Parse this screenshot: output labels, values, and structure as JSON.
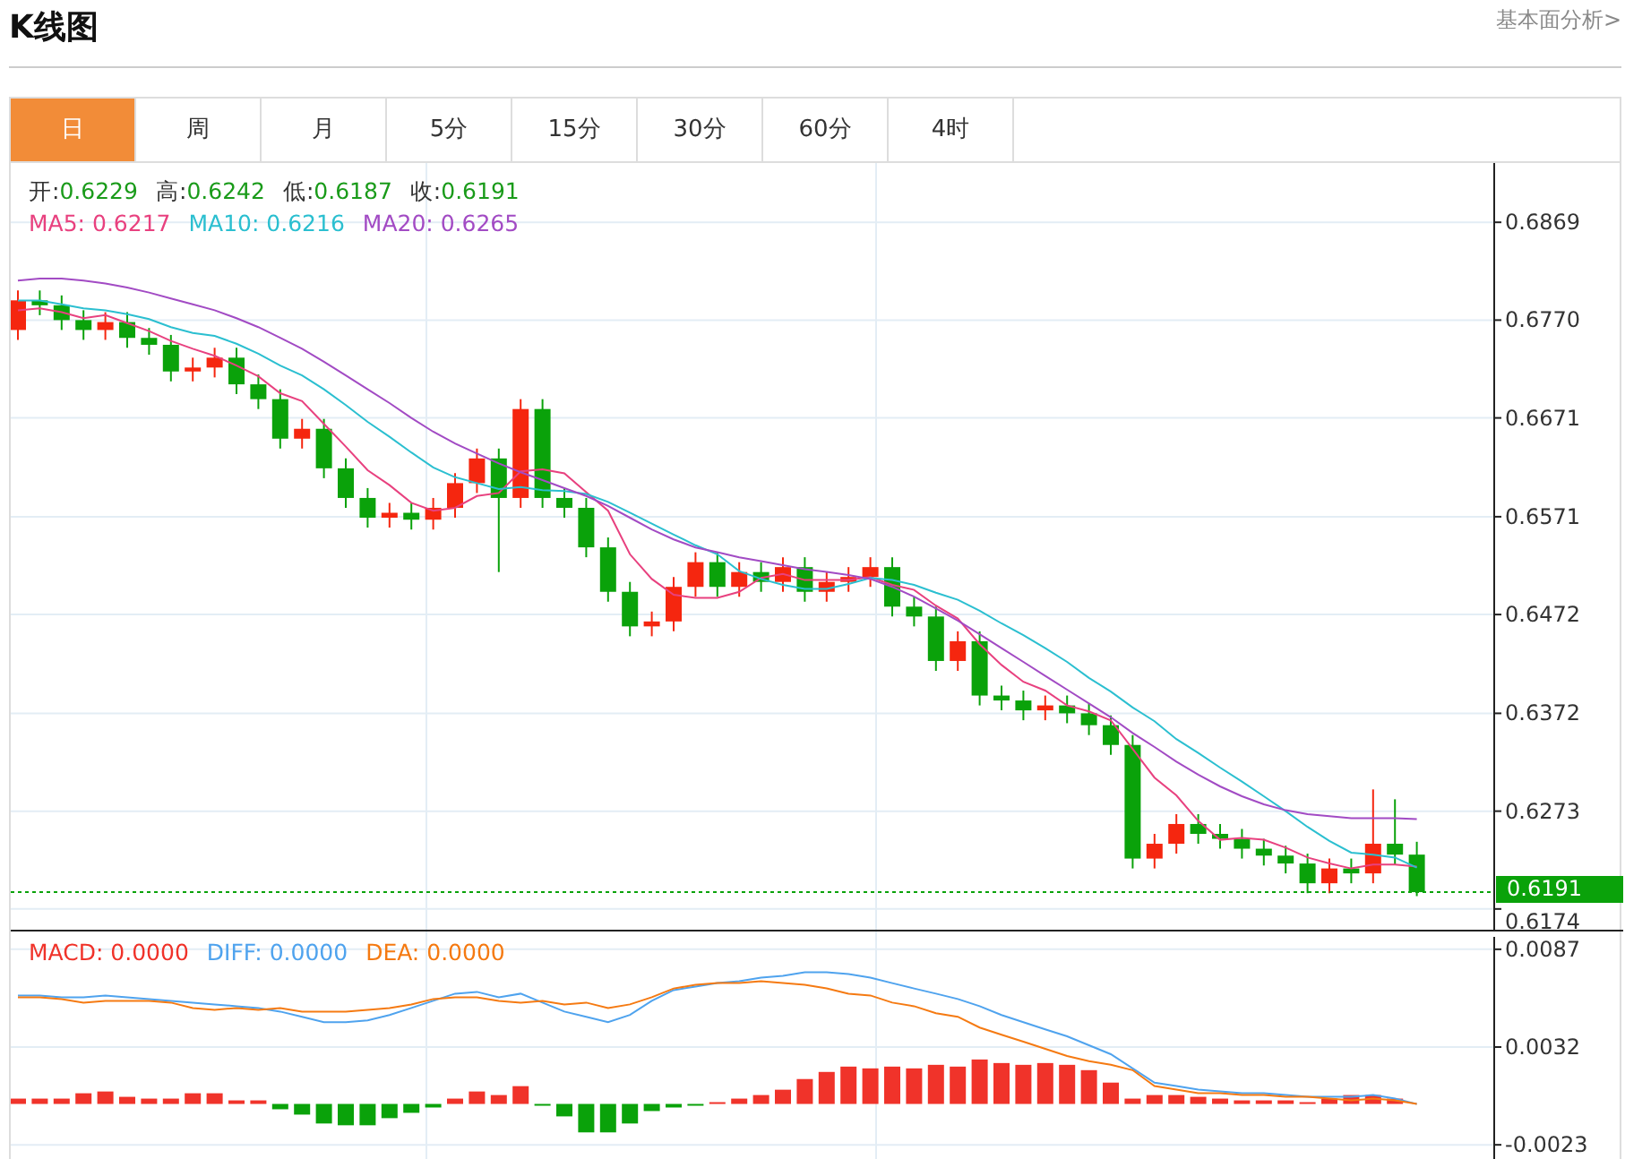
{
  "header": {
    "title": "K线图",
    "link": "基本面分析>"
  },
  "tabs": [
    {
      "label": "日",
      "selected": true
    },
    {
      "label": "周",
      "selected": false
    },
    {
      "label": "月",
      "selected": false
    },
    {
      "label": "5分",
      "selected": false
    },
    {
      "label": "15分",
      "selected": false
    },
    {
      "label": "30分",
      "selected": false
    },
    {
      "label": "60分",
      "selected": false
    },
    {
      "label": "4时",
      "selected": false
    }
  ],
  "quote": [
    {
      "label": "开:",
      "value": "0.6229"
    },
    {
      "label": "高:",
      "value": "0.6242"
    },
    {
      "label": "低:",
      "value": "0.6187"
    },
    {
      "label": "收:",
      "value": "0.6191"
    }
  ],
  "price_chart": {
    "legend": [
      {
        "value": "0.6217"
      },
      {
        "value": "0.6216"
      },
      {
        "value": "0.6265"
      }
    ],
    "chart_data": {
      "type": "candlestick",
      "grid": true,
      "ylim": [
        0.6153,
        0.6929
      ],
      "categories": [
        null,
        null,
        null,
        null,
        null,
        null,
        null,
        null,
        null,
        null,
        null,
        null,
        null,
        null,
        null,
        null,
        null,
        null,
        null,
        null,
        null,
        null,
        null,
        null,
        null,
        null,
        null,
        null,
        null,
        null,
        null,
        null,
        null,
        null,
        null,
        null,
        null,
        null,
        null,
        null,
        null,
        null,
        null,
        null,
        null,
        null,
        null,
        null,
        null,
        null,
        null,
        null,
        null,
        null,
        null,
        null,
        null,
        null,
        null,
        null,
        null,
        null,
        null,
        null,
        null
      ],
      "ohlc": [
        [
          0.676,
          0.68,
          0.675,
          0.679
        ],
        [
          0.679,
          0.68,
          0.6775,
          0.6785
        ],
        [
          0.6785,
          0.6795,
          0.676,
          0.677
        ],
        [
          0.677,
          0.678,
          0.675,
          0.676
        ],
        [
          0.676,
          0.6778,
          0.675,
          0.6768
        ],
        [
          0.6768,
          0.6778,
          0.6742,
          0.6752
        ],
        [
          0.6752,
          0.6762,
          0.6735,
          0.6745
        ],
        [
          0.6745,
          0.6755,
          0.6708,
          0.6718
        ],
        [
          0.6718,
          0.6732,
          0.6708,
          0.6722
        ],
        [
          0.6722,
          0.6742,
          0.6712,
          0.6732
        ],
        [
          0.6732,
          0.6742,
          0.6695,
          0.6705
        ],
        [
          0.6705,
          0.6715,
          0.668,
          0.669
        ],
        [
          0.669,
          0.67,
          0.664,
          0.665
        ],
        [
          0.665,
          0.667,
          0.664,
          0.666
        ],
        [
          0.666,
          0.667,
          0.661,
          0.662
        ],
        [
          0.662,
          0.663,
          0.658,
          0.659
        ],
        [
          0.659,
          0.66,
          0.656,
          0.657
        ],
        [
          0.657,
          0.6585,
          0.656,
          0.6575
        ],
        [
          0.6575,
          0.6585,
          0.6558,
          0.6568
        ],
        [
          0.6568,
          0.659,
          0.6558,
          0.658
        ],
        [
          0.658,
          0.6615,
          0.657,
          0.6605
        ],
        [
          0.6605,
          0.664,
          0.6595,
          0.663
        ],
        [
          0.663,
          0.664,
          0.6515,
          0.659
        ],
        [
          0.659,
          0.669,
          0.658,
          0.668
        ],
        [
          0.668,
          0.669,
          0.658,
          0.659
        ],
        [
          0.659,
          0.66,
          0.657,
          0.658
        ],
        [
          0.658,
          0.659,
          0.653,
          0.654
        ],
        [
          0.654,
          0.655,
          0.6485,
          0.6495
        ],
        [
          0.6495,
          0.6505,
          0.645,
          0.646
        ],
        [
          0.646,
          0.6475,
          0.645,
          0.6465
        ],
        [
          0.6465,
          0.651,
          0.6455,
          0.65
        ],
        [
          0.65,
          0.6535,
          0.649,
          0.6525
        ],
        [
          0.6525,
          0.6535,
          0.649,
          0.65
        ],
        [
          0.65,
          0.6525,
          0.649,
          0.6515
        ],
        [
          0.6515,
          0.6525,
          0.6495,
          0.6505
        ],
        [
          0.6505,
          0.653,
          0.6495,
          0.652
        ],
        [
          0.652,
          0.653,
          0.6485,
          0.6495
        ],
        [
          0.6495,
          0.6515,
          0.6485,
          0.6505
        ],
        [
          0.6505,
          0.652,
          0.6495,
          0.651
        ],
        [
          0.651,
          0.653,
          0.65,
          0.652
        ],
        [
          0.652,
          0.653,
          0.647,
          0.648
        ],
        [
          0.648,
          0.649,
          0.646,
          0.647
        ],
        [
          0.647,
          0.648,
          0.6415,
          0.6425
        ],
        [
          0.6425,
          0.6455,
          0.6415,
          0.6445
        ],
        [
          0.6445,
          0.6455,
          0.638,
          0.639
        ],
        [
          0.639,
          0.64,
          0.6375,
          0.6385
        ],
        [
          0.6385,
          0.6395,
          0.6365,
          0.6375
        ],
        [
          0.6375,
          0.639,
          0.6365,
          0.638
        ],
        [
          0.638,
          0.639,
          0.6362,
          0.6372
        ],
        [
          0.6372,
          0.6382,
          0.635,
          0.636
        ],
        [
          0.636,
          0.637,
          0.633,
          0.634
        ],
        [
          0.634,
          0.635,
          0.6215,
          0.6225
        ],
        [
          0.6225,
          0.625,
          0.6215,
          0.624
        ],
        [
          0.624,
          0.627,
          0.623,
          0.626
        ],
        [
          0.626,
          0.627,
          0.624,
          0.625
        ],
        [
          0.625,
          0.626,
          0.6235,
          0.6245
        ],
        [
          0.6245,
          0.6255,
          0.6225,
          0.6235
        ],
        [
          0.6235,
          0.6245,
          0.6218,
          0.6228
        ],
        [
          0.6228,
          0.6238,
          0.621,
          0.622
        ],
        [
          0.622,
          0.623,
          0.619,
          0.62
        ],
        [
          0.62,
          0.6225,
          0.619,
          0.6215
        ],
        [
          0.6215,
          0.6225,
          0.62,
          0.621
        ],
        [
          0.621,
          0.6295,
          0.62,
          0.624
        ],
        [
          0.624,
          0.6285,
          0.6219,
          0.6229
        ],
        [
          0.6229,
          0.6242,
          0.6187,
          0.6191
        ]
      ],
      "yticks": [
        {
          "value": 0.6869,
          "label": "0.6869"
        },
        {
          "value": 0.677,
          "label": "0.6770"
        },
        {
          "value": 0.6671,
          "label": "0.6671"
        },
        {
          "value": 0.6571,
          "label": "0.6571"
        },
        {
          "value": 0.6472,
          "label": "0.6472"
        },
        {
          "value": 0.6372,
          "label": "0.6372"
        },
        {
          "value": 0.6273,
          "label": "0.6273"
        },
        {
          "value": 0.6174,
          "label": "0.6174"
        }
      ],
      "ref_lines": [
        {
          "axis": "y",
          "value": 0.6191,
          "label": "0.6191",
          "color": "#0aa20a"
        }
      ],
      "series": [
        {
          "type": "line",
          "name": "MA5:",
          "color": "#e8417f",
          "values": [
            0.678,
            0.6782,
            0.6778,
            0.6772,
            0.6775,
            0.6767,
            0.6759,
            0.6749,
            0.6741,
            0.6734,
            0.6724,
            0.6713,
            0.6696,
            0.6688,
            0.6665,
            0.6642,
            0.6618,
            0.6603,
            0.6585,
            0.6577,
            0.658,
            0.6592,
            0.6595,
            0.6617,
            0.6619,
            0.6615,
            0.6596,
            0.6577,
            0.6533,
            0.6508,
            0.6492,
            0.6489,
            0.6489,
            0.6495,
            0.6509,
            0.6513,
            0.6507,
            0.6507,
            0.6507,
            0.651,
            0.6502,
            0.6497,
            0.6481,
            0.6468,
            0.6442,
            0.6421,
            0.6404,
            0.6395,
            0.638,
            0.6374,
            0.6365,
            0.6336,
            0.6307,
            0.6289,
            0.6263,
            0.6244,
            0.6246,
            0.6244,
            0.6236,
            0.6226,
            0.622,
            0.6215,
            0.6219,
            0.6219,
            0.6217
          ]
        },
        {
          "type": "line",
          "name": "MA10:",
          "color": "#2bbfd0",
          "values": [
            0.679,
            0.679,
            0.6786,
            0.6782,
            0.678,
            0.6776,
            0.6771,
            0.6763,
            0.6757,
            0.6754,
            0.6746,
            0.6736,
            0.6724,
            0.6714,
            0.67,
            0.6684,
            0.6667,
            0.6652,
            0.6636,
            0.6621,
            0.6611,
            0.6605,
            0.6599,
            0.6601,
            0.6598,
            0.6597,
            0.6594,
            0.6586,
            0.6575,
            0.6564,
            0.6553,
            0.6542,
            0.6533,
            0.6516,
            0.6508,
            0.6502,
            0.6498,
            0.6498,
            0.6503,
            0.6509,
            0.6507,
            0.6502,
            0.6494,
            0.6487,
            0.6476,
            0.6463,
            0.6451,
            0.6438,
            0.6424,
            0.6408,
            0.6394,
            0.6378,
            0.6364,
            0.6346,
            0.6332,
            0.6317,
            0.6303,
            0.6288,
            0.6273,
            0.6257,
            0.6243,
            0.6231,
            0.6229,
            0.6226,
            0.6216
          ]
        },
        {
          "type": "line",
          "name": "MA20:",
          "color": "#a24bc4",
          "values": [
            0.681,
            0.6812,
            0.6812,
            0.681,
            0.6807,
            0.6803,
            0.6798,
            0.6792,
            0.6786,
            0.678,
            0.6772,
            0.6763,
            0.6752,
            0.6741,
            0.6728,
            0.6714,
            0.67,
            0.6686,
            0.6671,
            0.6657,
            0.6645,
            0.6635,
            0.6625,
            0.6616,
            0.6608,
            0.66,
            0.6592,
            0.6582,
            0.657,
            0.6558,
            0.6548,
            0.654,
            0.6535,
            0.653,
            0.6526,
            0.6522,
            0.6518,
            0.6515,
            0.6512,
            0.6508,
            0.65,
            0.649,
            0.6478,
            0.6466,
            0.6452,
            0.6438,
            0.6424,
            0.641,
            0.6396,
            0.6382,
            0.6368,
            0.6352,
            0.6338,
            0.6323,
            0.631,
            0.6298,
            0.6288,
            0.628,
            0.6274,
            0.627,
            0.6268,
            0.6266,
            0.6266,
            0.6266,
            0.6265
          ]
        }
      ]
    }
  },
  "macd_chart": {
    "legend": [
      {
        "value": "0.0000"
      },
      {
        "value": "0.0000"
      },
      {
        "value": "0.0000"
      }
    ],
    "chart_data": {
      "type": "bar",
      "grid": true,
      "ylim": [
        -0.0034,
        0.0097
      ],
      "yticks": [
        {
          "value": 0.0087,
          "label": "0.0087"
        },
        {
          "value": 0.0032,
          "label": "0.0032"
        },
        {
          "value": -0.0023,
          "label": "-0.0023"
        }
      ],
      "categories": [
        null,
        null,
        null,
        null,
        null,
        null,
        null,
        null,
        null,
        null,
        null,
        null,
        null,
        null,
        null,
        null,
        null,
        null,
        null,
        null,
        null,
        null,
        null,
        null,
        null,
        null,
        null,
        null,
        null,
        null,
        null,
        null,
        null,
        null,
        null,
        null,
        null,
        null,
        null,
        null,
        null,
        null,
        null,
        null,
        null,
        null,
        null,
        null,
        null,
        null,
        null,
        null,
        null,
        null,
        null,
        null,
        null,
        null,
        null,
        null,
        null,
        null,
        null,
        null,
        null
      ],
      "series": [
        {
          "name": "MACD:",
          "color": "#f0332a",
          "values": [
            0.0003,
            0.0003,
            0.0003,
            0.0006,
            0.0007,
            0.0004,
            0.0003,
            0.0003,
            0.0006,
            0.0006,
            0.0002,
            0.0002,
            null,
            null,
            null,
            null,
            null,
            null,
            null,
            null,
            0.0003,
            0.0007,
            0.0005,
            0.001,
            null,
            null,
            null,
            null,
            null,
            null,
            null,
            null,
            0.0001,
            0.0003,
            0.0005,
            0.0008,
            0.0014,
            0.0018,
            0.0021,
            0.002,
            0.0021,
            0.002,
            0.0022,
            0.0021,
            0.0025,
            0.0023,
            0.0022,
            0.0023,
            0.0022,
            0.0019,
            0.0012,
            0.0003,
            0.0005,
            0.0005,
            0.0004,
            0.0003,
            0.0002,
            0.0002,
            0.0002,
            0.0001,
            0.0003,
            0.0005,
            0.0005,
            0.0003,
            null
          ]
        },
        {
          "color": "#0aa20a",
          "values": [
            null,
            null,
            null,
            null,
            null,
            null,
            null,
            null,
            null,
            null,
            null,
            null,
            -0.0003,
            -0.0006,
            -0.0011,
            -0.0012,
            -0.0012,
            -0.0008,
            -0.0005,
            -0.0002,
            null,
            null,
            null,
            null,
            -0.0001,
            -0.0007,
            -0.0016,
            -0.0016,
            -0.0011,
            -0.0004,
            -0.0002,
            -0.0001,
            null,
            null,
            null,
            null,
            null,
            null,
            null,
            null,
            null,
            null,
            null,
            null,
            null,
            null,
            null,
            null,
            null,
            null,
            null,
            null,
            null,
            null,
            null,
            null,
            null,
            null,
            null,
            null,
            null,
            null,
            null,
            null,
            null
          ]
        },
        {
          "type": "line",
          "name": "DIFF:",
          "color": "#4fa3ee",
          "values": [
            0.0061,
            0.0061,
            0.006,
            0.006,
            0.0061,
            0.006,
            0.0059,
            0.0058,
            0.0057,
            0.0056,
            0.0055,
            0.0054,
            0.0052,
            0.0049,
            0.0046,
            0.0046,
            0.0047,
            0.005,
            0.0054,
            0.0058,
            0.0062,
            0.0063,
            0.006,
            0.0062,
            0.0057,
            0.0052,
            0.0049,
            0.0046,
            0.005,
            0.0058,
            0.0064,
            0.0066,
            0.0068,
            0.0069,
            0.0071,
            0.0072,
            0.0074,
            0.0074,
            0.0073,
            0.0071,
            0.0068,
            0.0065,
            0.0062,
            0.0059,
            0.0055,
            0.005,
            0.0046,
            0.0042,
            0.0038,
            0.0033,
            0.0028,
            0.002,
            0.0012,
            0.001,
            0.0008,
            0.0007,
            0.0006,
            0.0006,
            0.0005,
            0.0004,
            0.0004,
            0.0004,
            0.0005,
            0.0003,
            0.0
          ]
        },
        {
          "type": "line",
          "name": "DEA:",
          "color": "#f57a12",
          "values": [
            0.006,
            0.006,
            0.0059,
            0.0057,
            0.0058,
            0.0058,
            0.0058,
            0.0057,
            0.0054,
            0.0053,
            0.0054,
            0.0053,
            0.0054,
            0.0052,
            0.0052,
            0.0052,
            0.0053,
            0.0054,
            0.0056,
            0.0059,
            0.006,
            0.006,
            0.0058,
            0.0057,
            0.0058,
            0.0056,
            0.0057,
            0.0054,
            0.0056,
            0.006,
            0.0065,
            0.0067,
            0.0068,
            0.0068,
            0.0069,
            0.0068,
            0.0067,
            0.0065,
            0.0062,
            0.0061,
            0.0057,
            0.0055,
            0.0051,
            0.0049,
            0.0043,
            0.0039,
            0.0035,
            0.0031,
            0.0027,
            0.0024,
            0.0022,
            0.0019,
            0.001,
            0.0008,
            0.0006,
            0.0006,
            0.0005,
            0.0005,
            0.0004,
            0.0004,
            0.0003,
            0.0002,
            0.0003,
            0.0002,
            0.0
          ]
        }
      ]
    }
  }
}
